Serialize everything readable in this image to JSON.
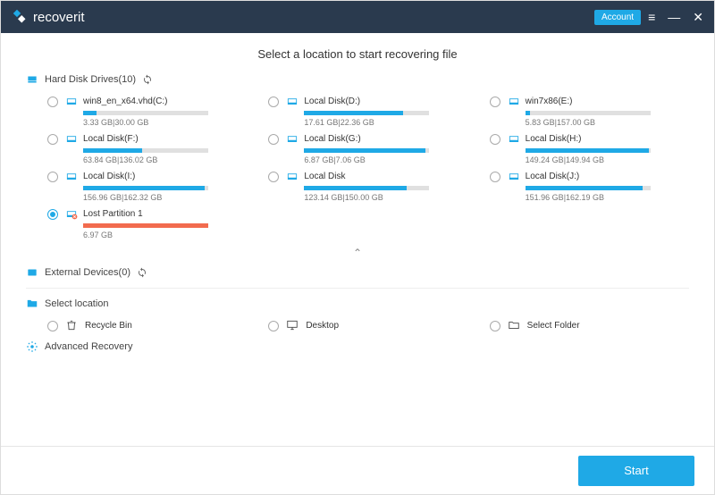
{
  "brand": "recoverit",
  "account_label": "Account",
  "page_title": "Select a location to start recovering file",
  "sections": {
    "hdd": {
      "label": "Hard Disk Drives(10)"
    },
    "ext": {
      "label": "External Devices(0)"
    },
    "sel": {
      "label": "Select location"
    },
    "adv": {
      "label": "Advanced Recovery"
    }
  },
  "drives": [
    {
      "name": "win8_en_x64.vhd(C:)",
      "size": "3.33  GB|30.00  GB",
      "pct": 11,
      "selected": false,
      "lost": false
    },
    {
      "name": "Local Disk(D:)",
      "size": "17.61  GB|22.36  GB",
      "pct": 79,
      "selected": false,
      "lost": false
    },
    {
      "name": "win7x86(E:)",
      "size": "5.83  GB|157.00  GB",
      "pct": 4,
      "selected": false,
      "lost": false
    },
    {
      "name": "Local Disk(F:)",
      "size": "63.84  GB|136.02  GB",
      "pct": 47,
      "selected": false,
      "lost": false
    },
    {
      "name": "Local Disk(G:)",
      "size": "6.87  GB|7.06  GB",
      "pct": 97,
      "selected": false,
      "lost": false
    },
    {
      "name": "Local Disk(H:)",
      "size": "149.24  GB|149.94  GB",
      "pct": 99,
      "selected": false,
      "lost": false
    },
    {
      "name": "Local Disk(I:)",
      "size": "156.96  GB|162.32  GB",
      "pct": 97,
      "selected": false,
      "lost": false
    },
    {
      "name": "Local Disk",
      "size": "123.14  GB|150.00  GB",
      "pct": 82,
      "selected": false,
      "lost": false
    },
    {
      "name": "Local Disk(J:)",
      "size": "151.96  GB|162.19  GB",
      "pct": 94,
      "selected": false,
      "lost": false
    },
    {
      "name": "Lost Partition 1",
      "size": "6.97  GB",
      "pct": 100,
      "selected": true,
      "lost": true
    }
  ],
  "select_location": [
    {
      "name": "Recycle Bin"
    },
    {
      "name": "Desktop"
    },
    {
      "name": "Select Folder"
    }
  ],
  "start_label": "Start",
  "colors": {
    "accent": "#1fa9e6",
    "header": "#2a3a4e",
    "lost": "#f26b4e"
  }
}
